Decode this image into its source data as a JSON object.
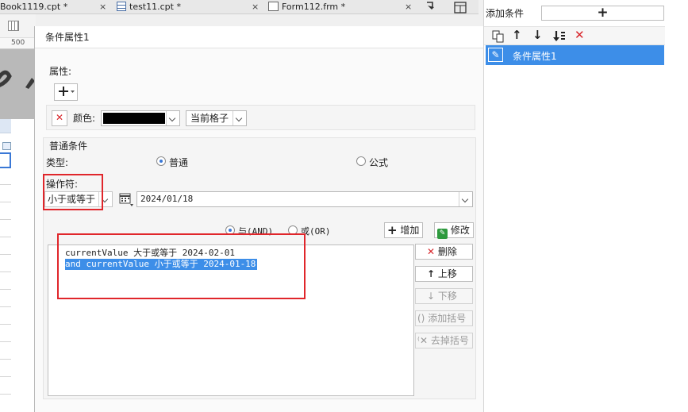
{
  "tabs": [
    {
      "label": "Book1119.cpt *",
      "close": "×"
    },
    {
      "label": "test11.cpt *",
      "close": "×"
    },
    {
      "label": "Form112.frm *",
      "close": "×"
    }
  ],
  "ruler_label": "500",
  "dialog": {
    "title": "条件属性1",
    "property_label": "属性:",
    "color_label": "颜色:",
    "color_value": "#000000",
    "scope_value": "当前格子",
    "condition_group_title": "普通条件",
    "type_label": "类型:",
    "type_options": [
      "普通",
      "公式"
    ],
    "type_selected": "普通",
    "operator_label": "操作符:",
    "operator_value": "小于或等于",
    "date_value": "2024/01/18",
    "logic_options": [
      "与(AND)",
      "或(OR)"
    ],
    "logic_selected": "与(AND)",
    "add_button": "增加",
    "modify_button": "修改",
    "conditions": [
      "currentValue 大于或等于 2024-02-01",
      "and currentValue 小于或等于 2024-01-18"
    ],
    "selected_condition_index": 1,
    "delete_button": "删除",
    "move_up_button": "上移",
    "move_down_button": "下移",
    "add_bracket_button": "添加括号",
    "remove_bracket_button": "去掉括号"
  },
  "right_panel": {
    "add_condition_label": "添加条件",
    "items": [
      "条件属性1"
    ],
    "selected_index": 0
  },
  "colors": {
    "highlight": "#3d8ee8",
    "annotation_red": "#e0262b",
    "delete_red": "#d8262b"
  }
}
